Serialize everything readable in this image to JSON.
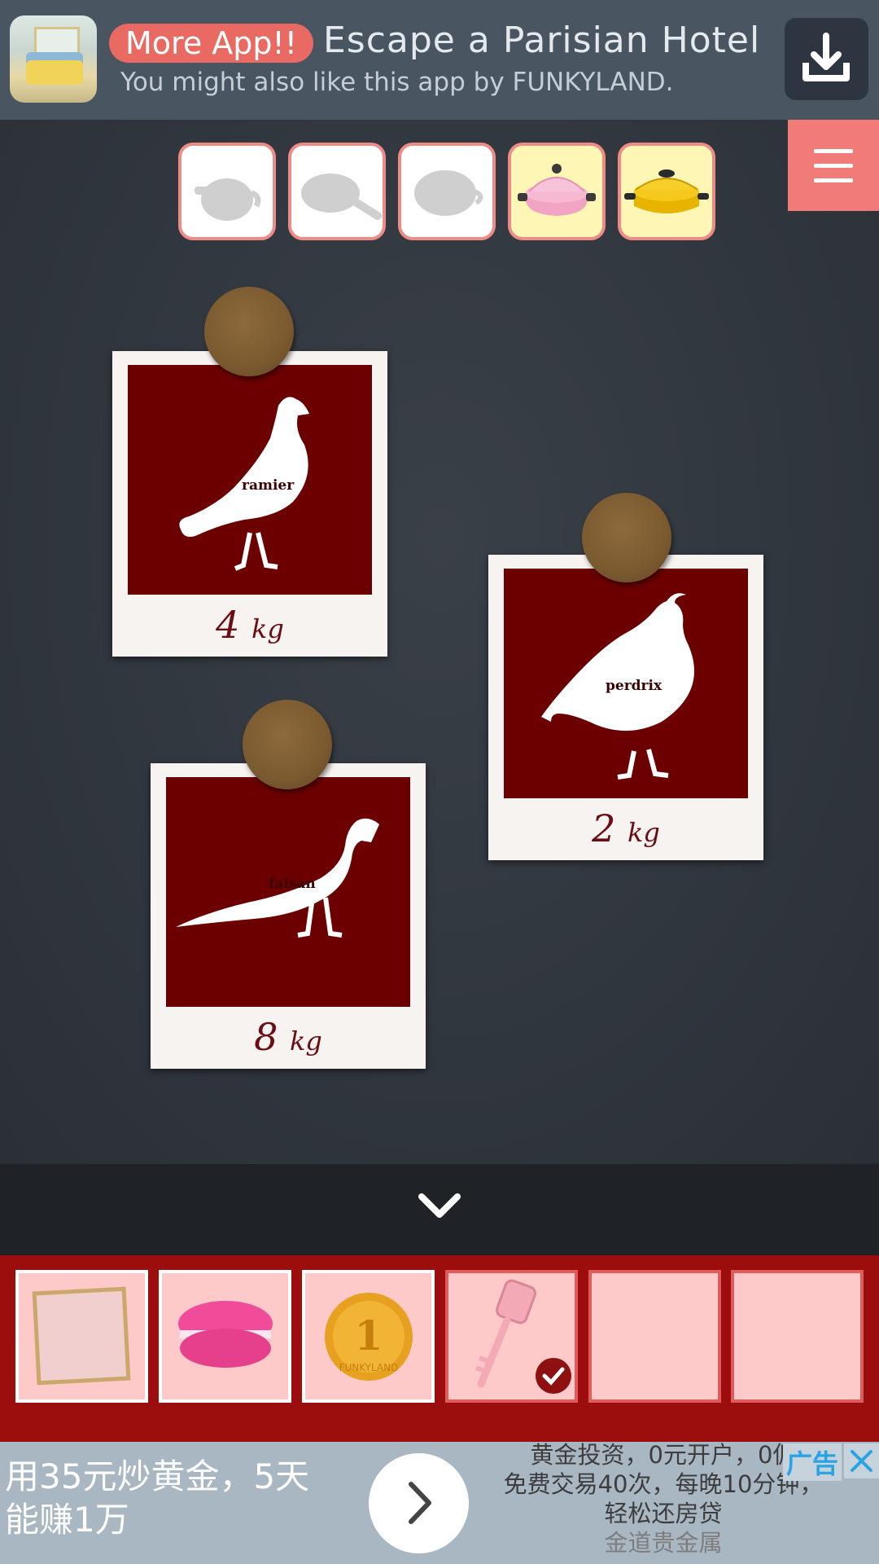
{
  "top_banner": {
    "pill_label": "More App!!",
    "title": "Escape a Parisian Hotel",
    "subtitle": "You might also like this app by FUNKYLAND.",
    "thumbnail_icon": "hotel-room-thumbnail",
    "download_icon": "download-icon"
  },
  "menu": {
    "icon": "hamburger-menu-icon"
  },
  "collected_slots": [
    {
      "item": "teapot",
      "state": "empty"
    },
    {
      "item": "frying-pan",
      "state": "empty"
    },
    {
      "item": "saucepan",
      "state": "empty"
    },
    {
      "item": "pink-flower-pot",
      "state": "filled"
    },
    {
      "item": "yellow-casserole-pot",
      "state": "filled"
    }
  ],
  "cards": [
    {
      "bird_label": "ramier",
      "weight": "4",
      "unit": "kg"
    },
    {
      "bird_label": "perdrix",
      "weight": "2",
      "unit": "kg"
    },
    {
      "bird_label": "faisan",
      "weight": "8",
      "unit": "kg"
    }
  ],
  "collapse": {
    "icon": "chevron-down-icon"
  },
  "inventory": [
    {
      "item": "picture-frame",
      "selected": false
    },
    {
      "item": "pink-macaron",
      "selected": false
    },
    {
      "item": "funkyland-coin",
      "coin_text": "1",
      "coin_brand": "FUNKYLAND",
      "selected": false
    },
    {
      "item": "pink-key",
      "selected": true,
      "icon": "checkmark-icon"
    },
    {
      "item": "empty",
      "selected": false
    },
    {
      "item": "empty",
      "selected": false
    }
  ],
  "bottom_ad": {
    "left_line1": "用35元炒黄金，5天",
    "left_line2": "能赚1万",
    "right_line1": "黄金投资，0元开户，0佣",
    "right_line2": "免费交易40次，每晚10分钟，",
    "right_line3": "轻松还房贷",
    "source": "金道贵金属",
    "tag": "广告",
    "colors": {
      "tag": "#2aa3e2",
      "background": "#a9b7c3"
    }
  },
  "colors": {
    "accent": "#f07b78",
    "card_photo": "#6c0000",
    "inventory_bg": "#9c0e0e",
    "slot_border": "#f08a86"
  }
}
